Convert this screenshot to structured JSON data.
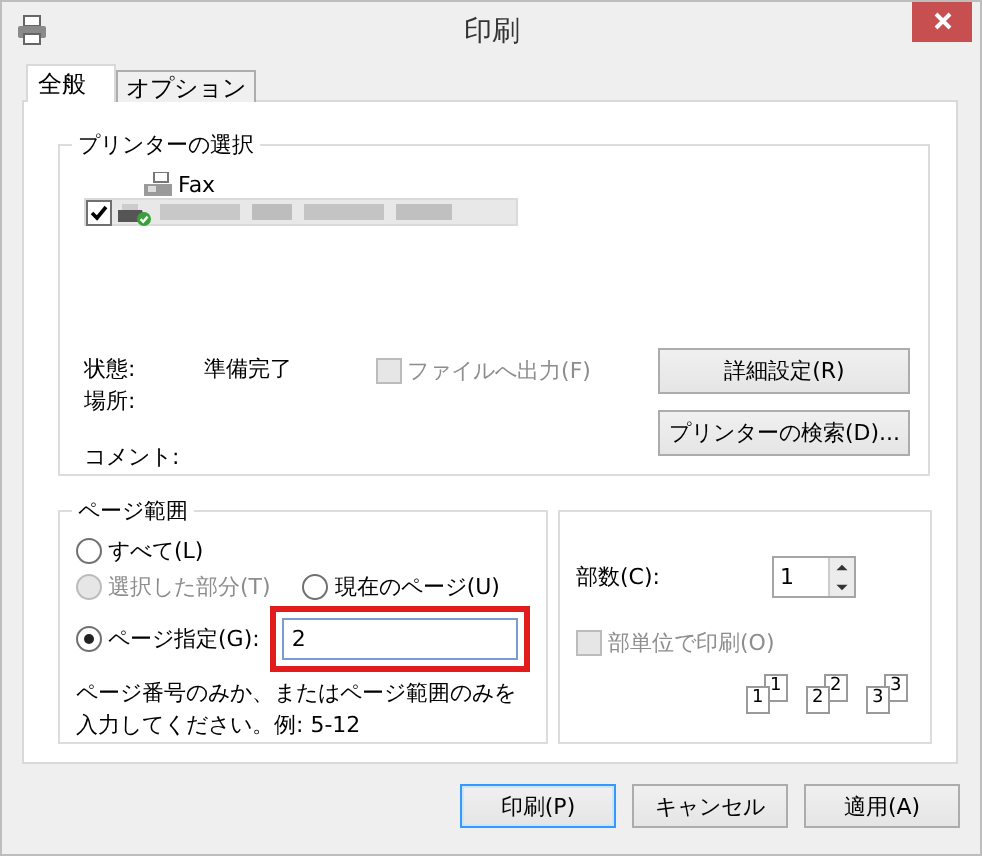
{
  "window": {
    "title": "印刷"
  },
  "tabs": [
    {
      "label": "全般",
      "selected": true
    },
    {
      "label": "オプション",
      "selected": false
    }
  ],
  "printer_selection": {
    "title": "プリンターの選択",
    "printers": [
      {
        "kind": "fax",
        "name": "Fax",
        "selected": false,
        "default": false
      },
      {
        "kind": "printer",
        "selected": true,
        "default": true
      }
    ],
    "status_label": "状態:",
    "status": "準備完了",
    "location_label": "場所:",
    "comment_label": "コメント:",
    "print_to_file": {
      "label": "ファイルへ出力(F)",
      "checked": false,
      "disabled": true
    },
    "buttons": [
      "詳細設定(R)",
      "プリンターの検索(D)..."
    ]
  },
  "page_range": {
    "title": "ページ範囲",
    "options": [
      {
        "label": "すべて(L)",
        "selected": false,
        "disabled": false
      },
      {
        "label": "選択した部分(T)",
        "selected": false,
        "disabled": true
      },
      {
        "label": "現在のページ(U)",
        "selected": false,
        "disabled": false
      },
      {
        "label": "ページ指定(G):",
        "selected": true,
        "disabled": false
      }
    ],
    "pages_field": {
      "value": "2",
      "highlighted": true
    },
    "hint": "ページ番号のみか、またはページ範囲のみを入力してください。例: 5-12"
  },
  "copies": {
    "label": "部数(C):",
    "value": "1",
    "collate": {
      "label": "部単位で印刷(O)",
      "checked": false,
      "disabled": true
    },
    "collate_pages": [
      {
        "back": "1",
        "front": "1"
      },
      {
        "back": "2",
        "front": "2"
      },
      {
        "back": "3",
        "front": "3"
      }
    ]
  },
  "buttons": [
    {
      "label": "印刷(P)",
      "default": true
    },
    {
      "label": "キャンセル",
      "default": false
    },
    {
      "label": "適用(A)",
      "default": false
    }
  ]
}
